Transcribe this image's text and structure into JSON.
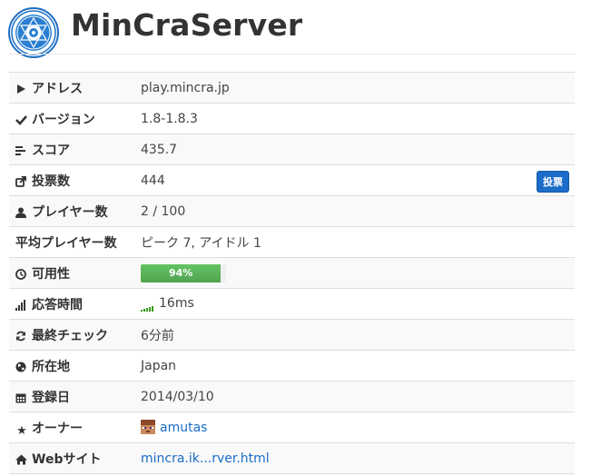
{
  "header": {
    "title": "MinCraServer"
  },
  "rows": [
    {
      "icon": "play-icon",
      "label": "アドレス",
      "value": "play.mincra.jp"
    },
    {
      "icon": "check-icon",
      "label": "バージョン",
      "value": "1.8-1.8.3"
    },
    {
      "icon": "align-left-icon",
      "label": "スコア",
      "value": "435.7"
    },
    {
      "icon": "share-icon",
      "label": "投票数",
      "value": "444",
      "button": "投票"
    },
    {
      "icon": "user-icon",
      "label": "プレイヤー数",
      "value": "2 / 100"
    },
    {
      "icon": "",
      "label": "平均プレイヤー数",
      "value": "ピーク 7, アイドル 1"
    },
    {
      "icon": "clock-icon",
      "label": "可用性",
      "value": "94%",
      "progress_percent": 94
    },
    {
      "icon": "signal-icon",
      "label": "応答時間",
      "value": "16ms"
    },
    {
      "icon": "refresh-icon",
      "label": "最終チェック",
      "value": "6分前"
    },
    {
      "icon": "globe-icon",
      "label": "所在地",
      "value": "Japan"
    },
    {
      "icon": "calendar-icon",
      "label": "登録日",
      "value": "2014/03/10"
    },
    {
      "icon": "star-icon",
      "label": "オーナー",
      "value": "amutas"
    },
    {
      "icon": "home-icon",
      "label": "Webサイト",
      "value": "mincra.ik...rver.html"
    }
  ],
  "colors": {
    "link": "#1a6cc8",
    "progress": "#5cb85c",
    "button": "#1a6cc8"
  }
}
